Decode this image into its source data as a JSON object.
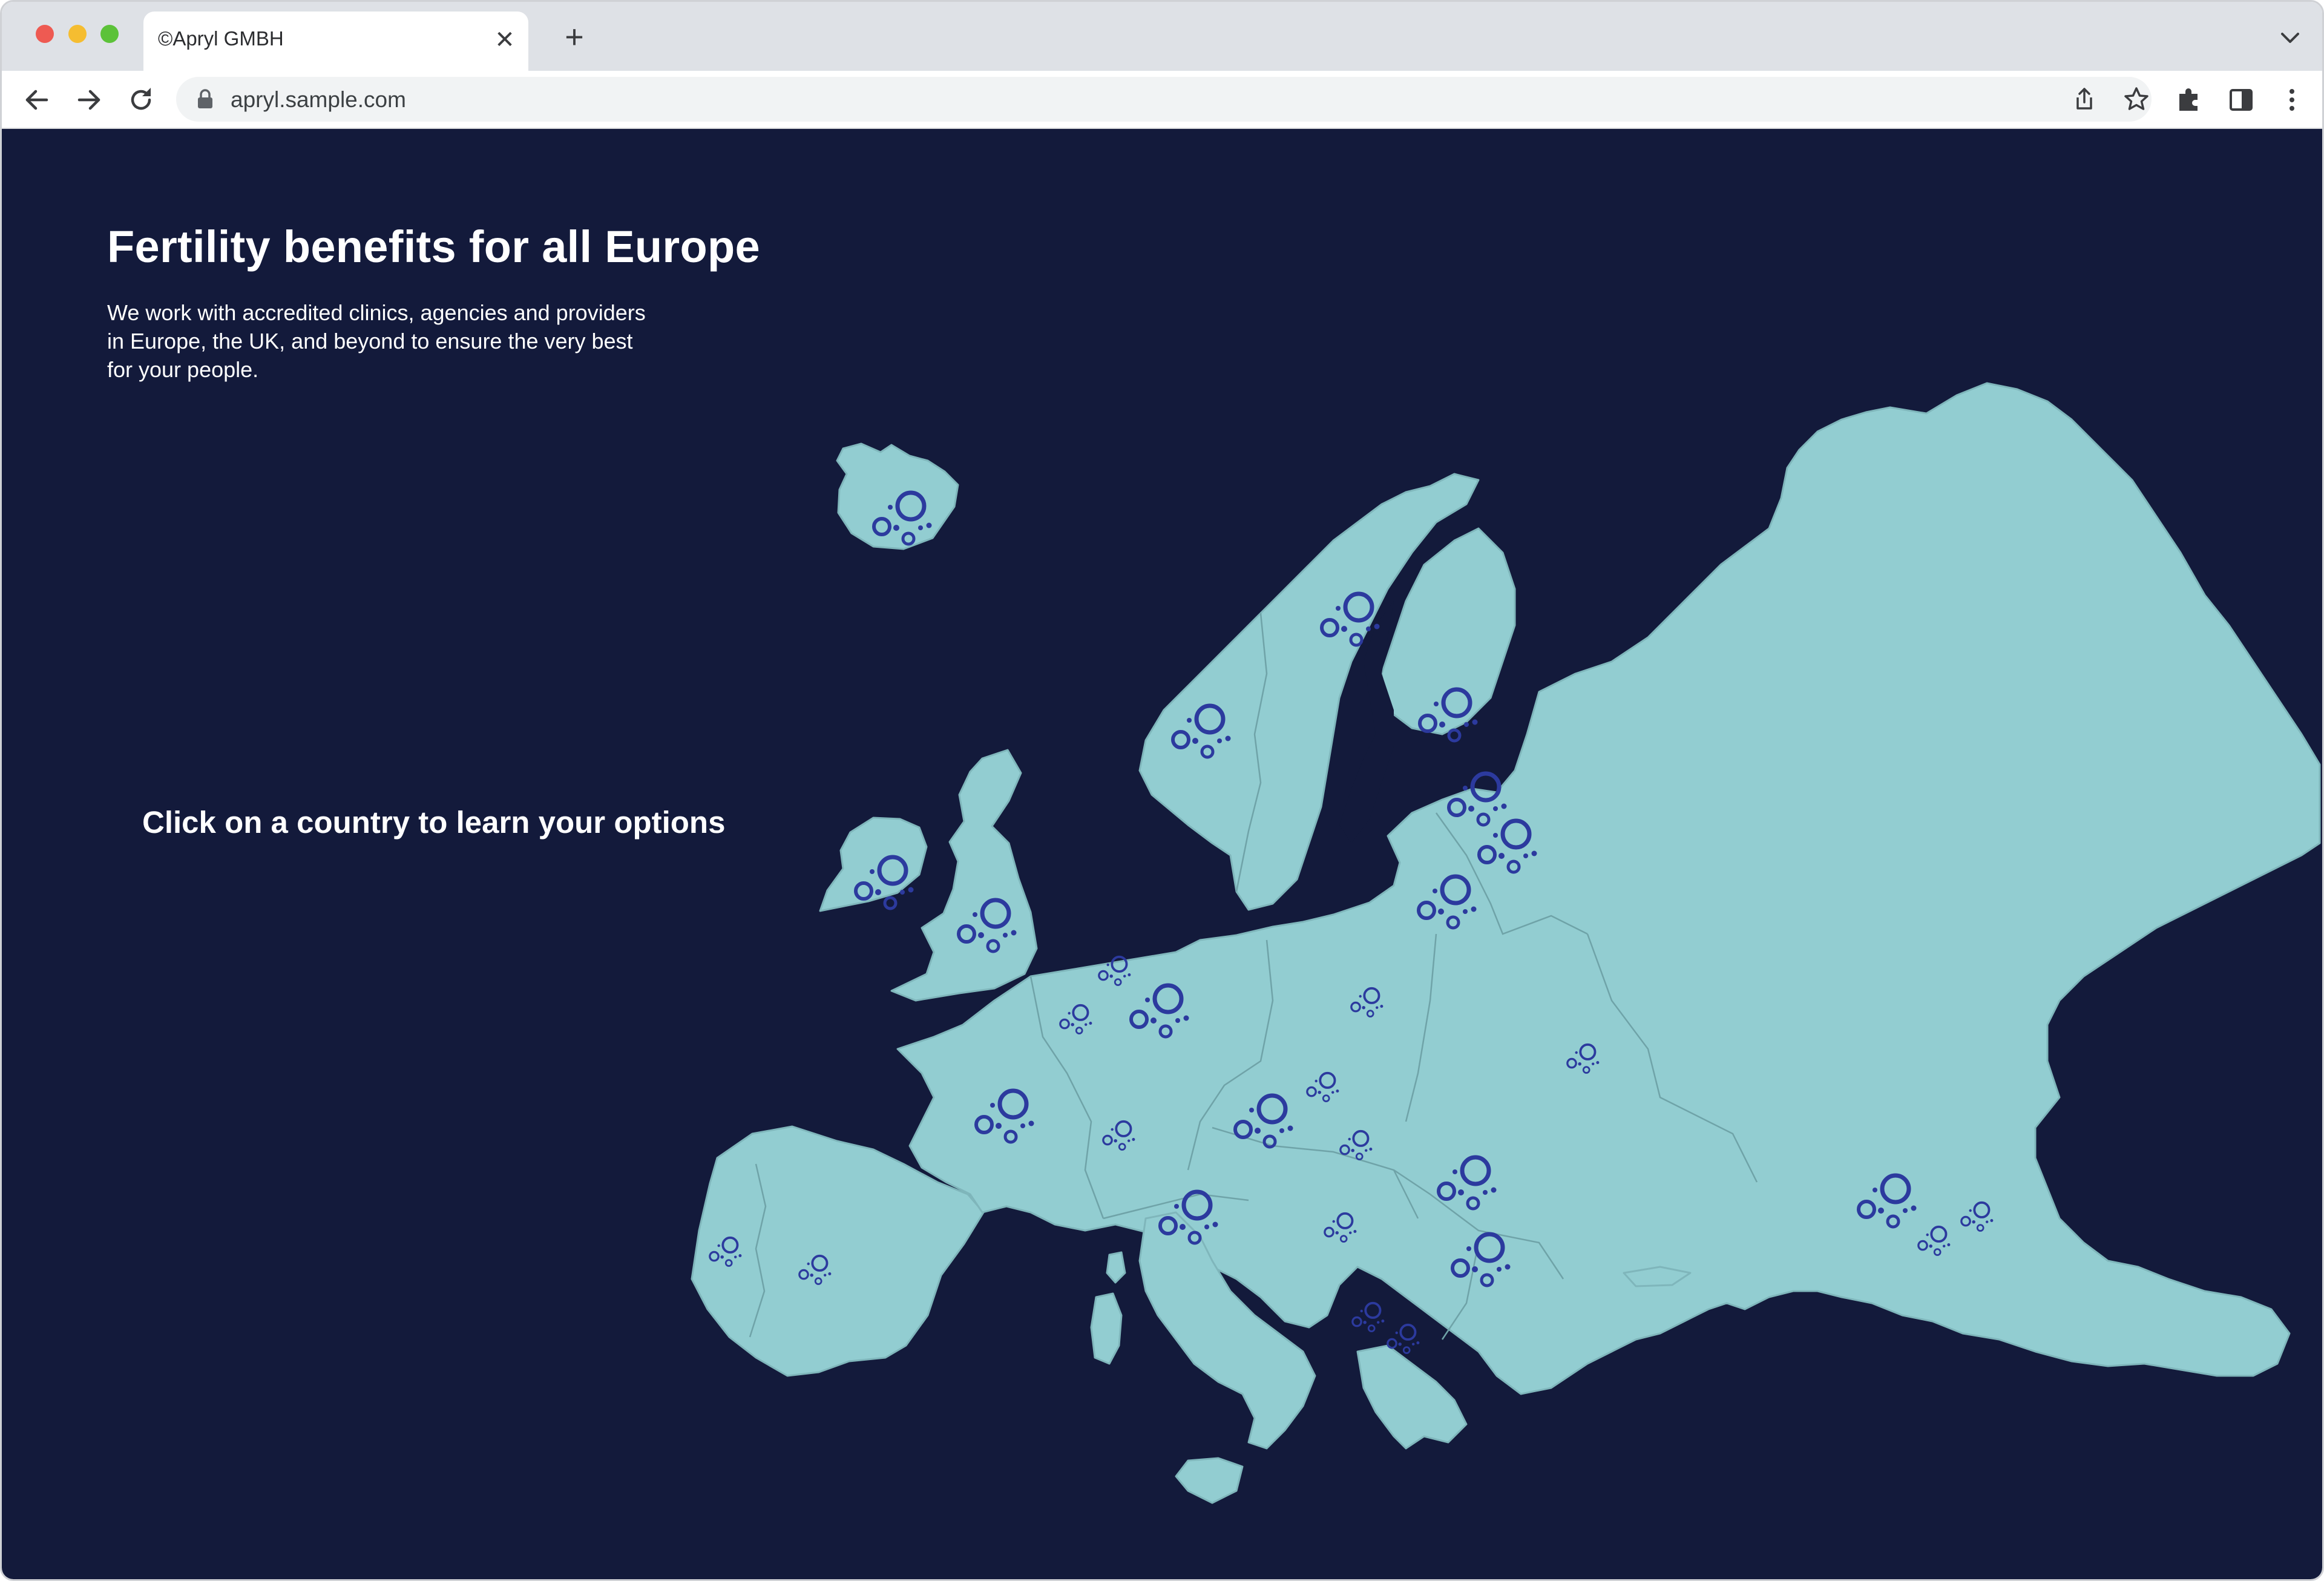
{
  "browser": {
    "tab_title": "©Apryl GMBH",
    "url": "apryl.sample.com",
    "tab_close_symbol": "✕",
    "new_tab_symbol": "+"
  },
  "page": {
    "heading": "Fertility benefits for all Europe",
    "subtext": "We work with accredited clinics, agencies and providers\nin Europe, the UK, and beyond to ensure the very best\nfor your people.",
    "cta": "Click on a country to learn your options"
  },
  "colors": {
    "page_background": "#131a3b",
    "land": "#92cdd1",
    "marker": "#2c3a9e",
    "text": "#ffffff"
  },
  "map": {
    "countries_with_large_markers": [
      "Iceland",
      "Norway",
      "Sweden",
      "Finland",
      "Ireland",
      "United Kingdom",
      "Estonia",
      "Latvia",
      "Lithuania",
      "Germany",
      "France",
      "Austria",
      "Italy",
      "Romania",
      "Bulgaria",
      "Turkey"
    ],
    "countries_with_small_markers": [
      "Belgium",
      "Netherlands",
      "Switzerland",
      "Poland",
      "Czechia",
      "Hungary",
      "Serbia",
      "Ukraine",
      "Portugal",
      "Spain",
      "North Macedonia",
      "Greece",
      "Turkey (east)"
    ]
  }
}
